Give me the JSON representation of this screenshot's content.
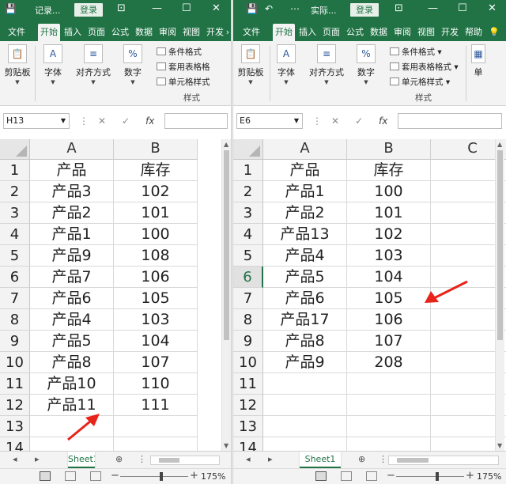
{
  "left": {
    "title": "记录...",
    "login_label": "登录",
    "tabs": [
      "文件",
      "开始",
      "插入",
      "页面",
      "公式",
      "数据",
      "审阅",
      "视图",
      "开发"
    ],
    "ribbon": {
      "clipboard": "剪贴板",
      "font": "字体",
      "align": "对齐方式",
      "number": "数字",
      "cond_format": "条件格式",
      "table_format": "套用表格格",
      "cell_style": "单元格样式",
      "styles": "样式",
      "fx": "fx",
      "percent": "%",
      "font_a": "A"
    },
    "name_box": "H13",
    "columns": [
      "A",
      "B"
    ],
    "rows": [
      "1",
      "2",
      "3",
      "4",
      "5",
      "6",
      "7",
      "8",
      "9",
      "10",
      "11",
      "12",
      "13",
      "14"
    ],
    "cells": [
      [
        "产品",
        "库存"
      ],
      [
        "产品3",
        "102"
      ],
      [
        "产品2",
        "101"
      ],
      [
        "产品1",
        "100"
      ],
      [
        "产品9",
        "108"
      ],
      [
        "产品7",
        "106"
      ],
      [
        "产品6",
        "105"
      ],
      [
        "产品4",
        "103"
      ],
      [
        "产品5",
        "104"
      ],
      [
        "产品8",
        "107"
      ],
      [
        "产品10",
        "110"
      ],
      [
        "产品11",
        "111"
      ],
      [
        "",
        ""
      ],
      [
        "",
        ""
      ]
    ],
    "sheet_tab": "Sheet1",
    "zoom": "175%"
  },
  "right": {
    "title": "实际...",
    "login_label": "登录",
    "tabs": [
      "文件",
      "开始",
      "插入",
      "页面",
      "公式",
      "数据",
      "审阅",
      "视图",
      "开发",
      "帮助"
    ],
    "ribbon": {
      "clipboard": "剪贴板",
      "font": "字体",
      "align": "对齐方式",
      "number": "数字",
      "cond_format": "条件格式",
      "table_format": "套用表格格式",
      "cell_style": "单元格样式",
      "styles": "样式",
      "fx": "fx",
      "percent": "%",
      "font_a": "A",
      "extra": "单"
    },
    "name_box": "E6",
    "columns": [
      "A",
      "B",
      "C"
    ],
    "rows": [
      "1",
      "2",
      "3",
      "4",
      "5",
      "6",
      "7",
      "8",
      "9",
      "10",
      "11",
      "12",
      "13",
      "14"
    ],
    "selected_row": "6",
    "cells": [
      [
        "产品",
        "库存",
        ""
      ],
      [
        "产品1",
        "100",
        ""
      ],
      [
        "产品2",
        "101",
        ""
      ],
      [
        "产品13",
        "102",
        ""
      ],
      [
        "产品4",
        "103",
        ""
      ],
      [
        "产品5",
        "104",
        ""
      ],
      [
        "产品6",
        "105",
        ""
      ],
      [
        "产品17",
        "106",
        ""
      ],
      [
        "产品8",
        "107",
        ""
      ],
      [
        "产品9",
        "208",
        ""
      ],
      [
        "",
        "",
        ""
      ],
      [
        "",
        "",
        ""
      ],
      [
        "",
        "",
        ""
      ],
      [
        "",
        "",
        ""
      ]
    ],
    "sheet_tab": "Sheet1",
    "zoom": "175%"
  },
  "colors": {
    "excel_green": "#217346",
    "annotation_red": "#e8231a"
  }
}
